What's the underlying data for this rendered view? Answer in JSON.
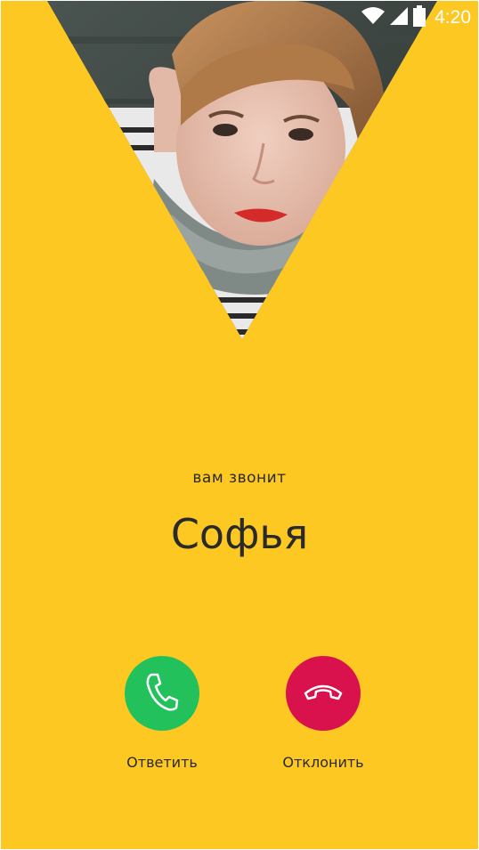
{
  "status_bar": {
    "time": "4:20",
    "icons": [
      "wifi-icon",
      "signal-icon",
      "battery-icon"
    ]
  },
  "call": {
    "caption": "вам звонит",
    "caller_name": "Софья",
    "answer_label": "Ответить",
    "decline_label": "Отклонить"
  },
  "colors": {
    "background": "#FEC822",
    "answer_button": "#23C15C",
    "decline_button": "#D9124E",
    "text": "#2a2a2a"
  }
}
